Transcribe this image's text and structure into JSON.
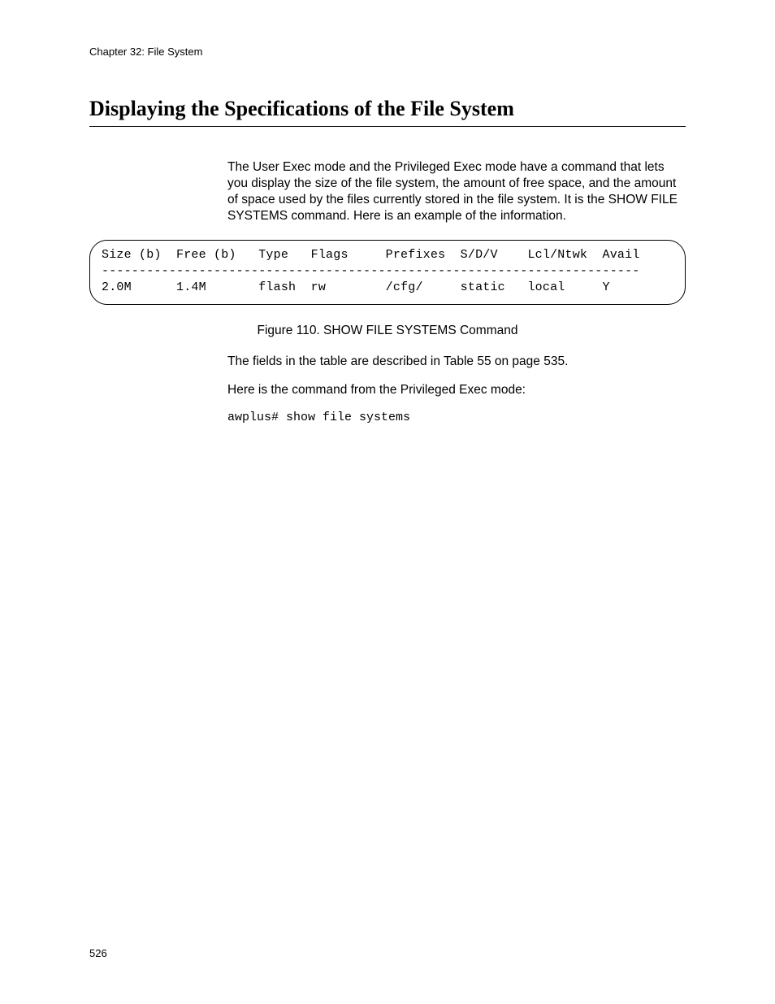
{
  "chapter_label": "Chapter 32: File System",
  "section_title": "Displaying the Specifications of the File System",
  "intro_paragraph": "The User Exec mode and the Privileged Exec mode have a command that lets you display the size of the file system, the amount of free space, and the amount of space used by the files currently stored in the file system. It is the SHOW FILE SYSTEMS command. Here is an example of the information.",
  "cli_output": "Size (b)  Free (b)   Type   Flags     Prefixes  S/D/V    Lcl/Ntwk  Avail\n------------------------------------------------------------------------\n2.0M      1.4M       flash  rw        /cfg/     static   local     Y",
  "figure_caption": "Figure 110. SHOW FILE SYSTEMS Command",
  "fields_paragraph": "The fields in the table are described in Table 55 on page 535.",
  "heres_command_paragraph": "Here is the command from the Privileged Exec mode:",
  "command_line": "awplus# show file systems",
  "page_number": "526"
}
